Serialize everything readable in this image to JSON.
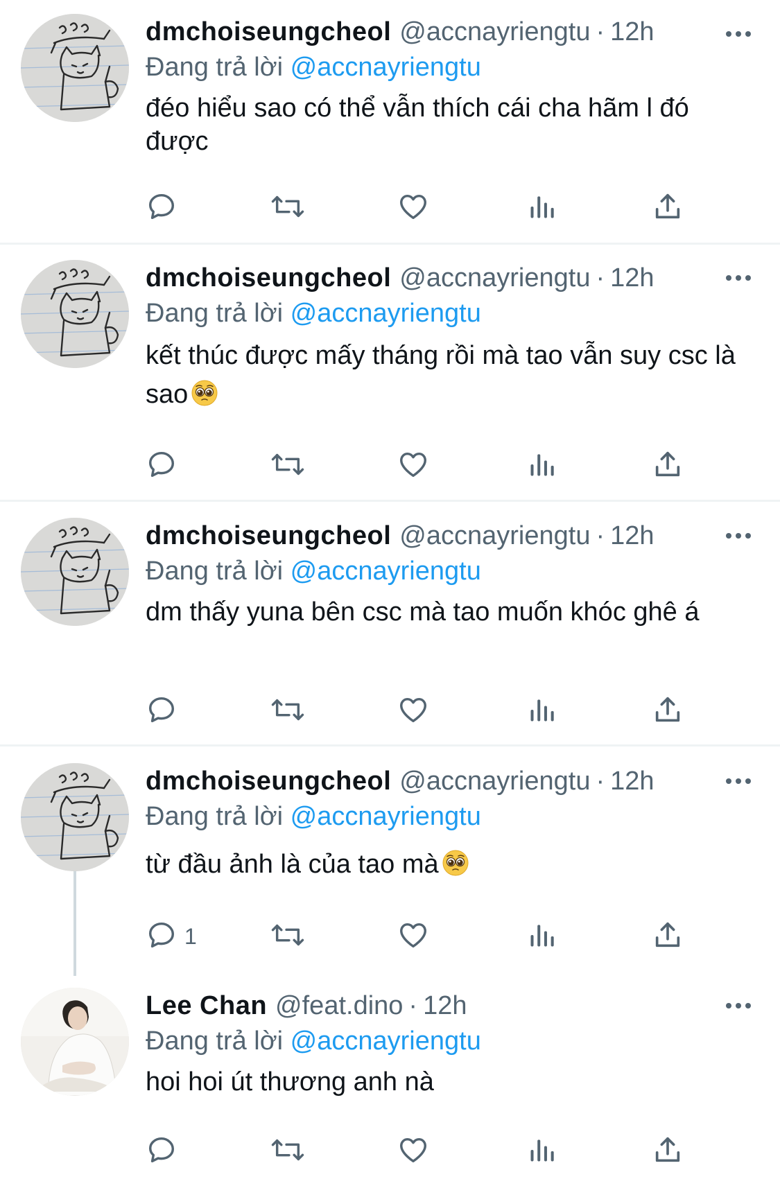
{
  "reply_prefix": "Đang trả lời",
  "colors": {
    "accent": "#1d9bf0",
    "secondary_text": "#536471",
    "divider": "#eff3f4",
    "thread_line": "#cfd9de"
  },
  "icons": [
    "reply-icon",
    "retweet-icon",
    "like-icon",
    "views-icon",
    "share-icon",
    "more-icon",
    "pleading-face-emoji"
  ],
  "tweets": [
    {
      "name": "dmchoiseungcheol",
      "handle": "@accnayriengtu",
      "separator": "·",
      "time": "12h",
      "reply_to": "@accnayriengtu",
      "text": "đéo hiểu sao có thể vẫn thích cái cha hãm l đó được",
      "reply_count": ""
    },
    {
      "name": "dmchoiseungcheol",
      "handle": "@accnayriengtu",
      "separator": "·",
      "time": "12h",
      "reply_to": "@accnayriengtu",
      "text": "kết thúc được mấy tháng rồi mà tao vẫn suy csc là sao",
      "reply_count": ""
    },
    {
      "name": "dmchoiseungcheol",
      "handle": "@accnayriengtu",
      "separator": "·",
      "time": "12h",
      "reply_to": "@accnayriengtu",
      "text": "dm thấy yuna bên csc mà tao muốn khóc ghê á",
      "reply_count": ""
    },
    {
      "name": "dmchoiseungcheol",
      "handle": "@accnayriengtu",
      "separator": "·",
      "time": "12h",
      "reply_to": "@accnayriengtu",
      "text": "từ đầu ảnh là của tao mà",
      "reply_count": "1"
    },
    {
      "name": "Lee Chan",
      "handle": "@feat.dino",
      "separator": "·",
      "time": "12h",
      "reply_to": "@accnayriengtu",
      "text": "hoi hoi út thương anh nà",
      "reply_count": ""
    }
  ]
}
